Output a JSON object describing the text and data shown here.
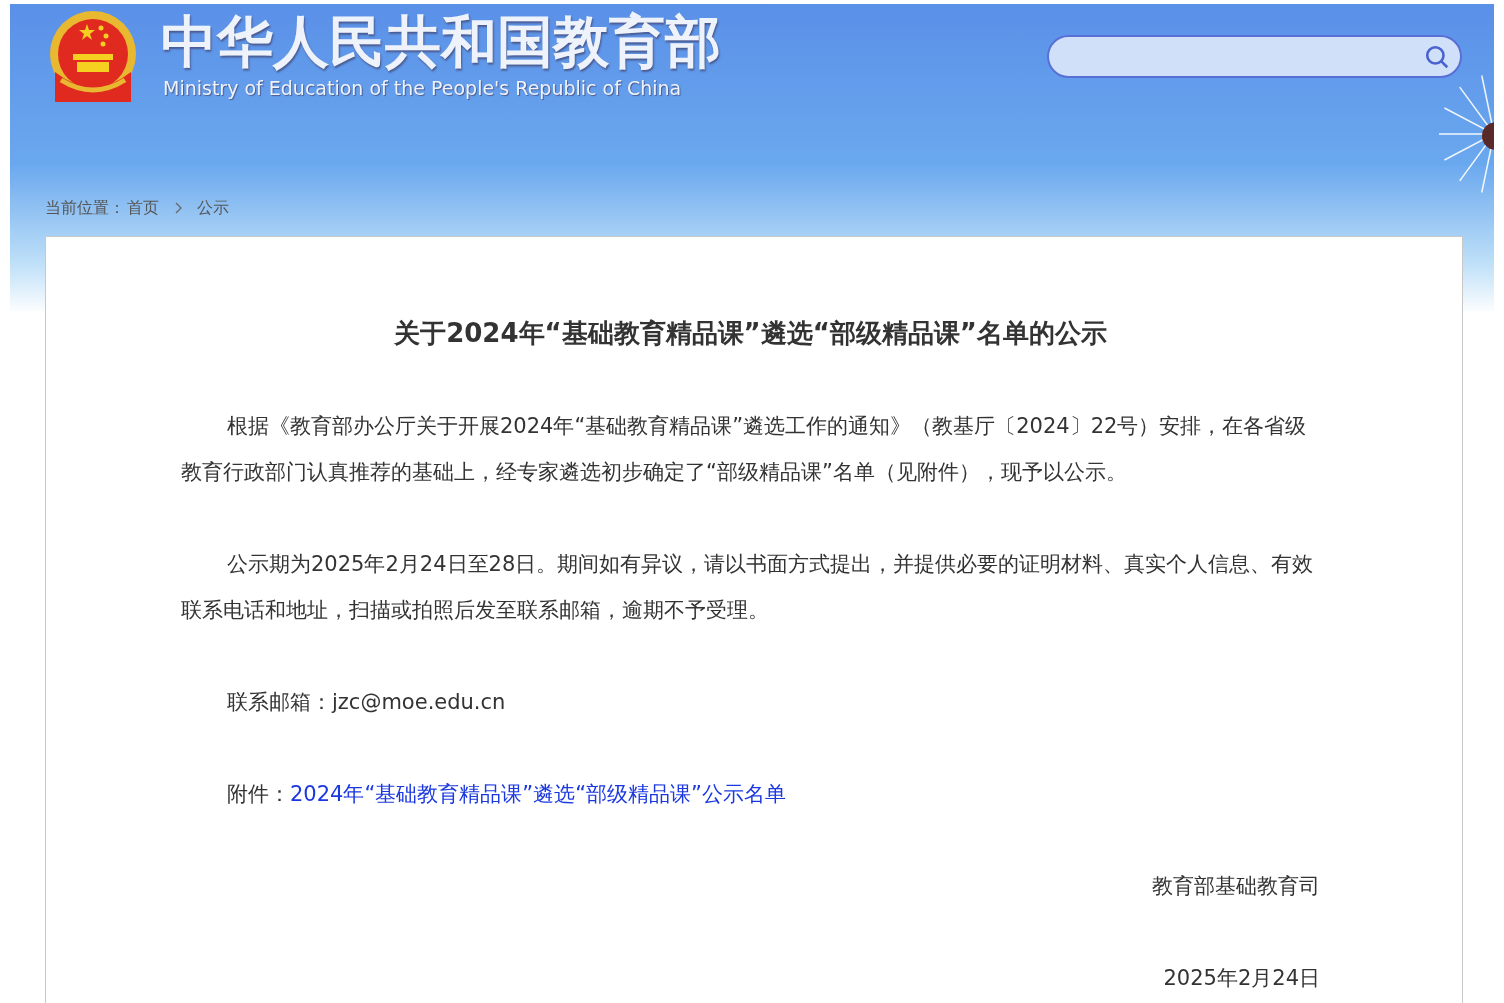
{
  "header": {
    "title": "中华人民共和国教育部",
    "subtitle": "Ministry of Education of the People's Republic of China"
  },
  "breadcrumb": {
    "label": "当前位置：",
    "items": [
      "首页",
      "公示"
    ]
  },
  "article": {
    "title": "关于2024年“基础教育精品课”遴选“部级精品课”名单的公示",
    "paragraphs": [
      "根据《教育部办公厅关于开展2024年“基础教育精品课”遴选工作的通知》（教基厅〔2024〕22号）安排，在各省级教育行政部门认真推荐的基础上，经专家遴选初步确定了“部级精品课”名单（见附件），现予以公示。",
      "公示期为2025年2月24日至28日。期间如有异议，请以书面方式提出，并提供必要的证明材料、真实个人信息、有效联系电话和地址，扫描或拍照后发至联系邮箱，逾期不予受理。"
    ],
    "contact": {
      "label": "联系邮箱：",
      "value": "jzc@moe.edu.cn"
    },
    "attachment": {
      "label": "附件：",
      "link": "2024年“基础教育精品课”遴选“部级精品课”公示名单"
    },
    "signature": "教育部基础教育司",
    "date": "2025年2月24日"
  }
}
